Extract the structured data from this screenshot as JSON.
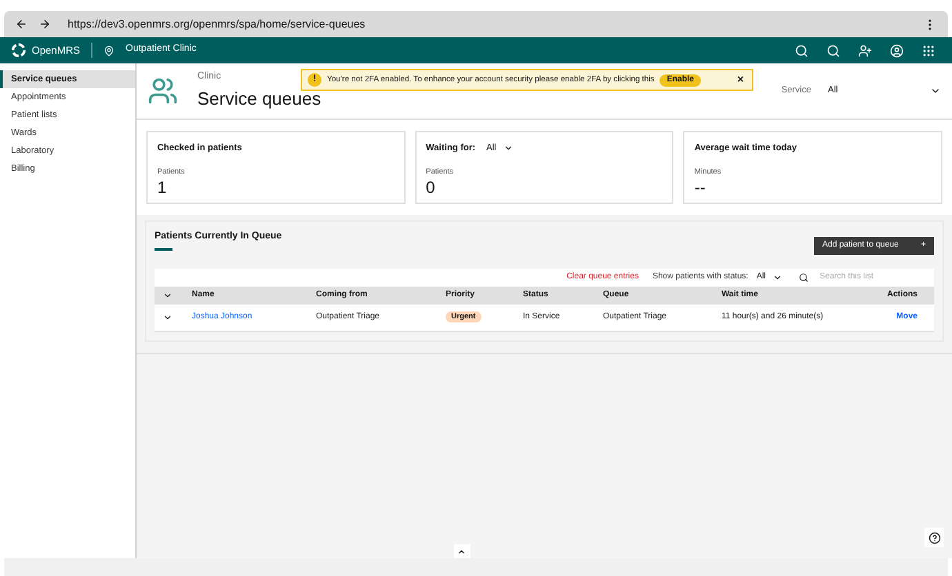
{
  "browser": {
    "url": "https://dev3.openmrs.org/openmrs/spa/home/service-queues"
  },
  "header": {
    "brand": "OpenMRS",
    "location": "Outpatient Clinic"
  },
  "sidebar": {
    "items": [
      {
        "label": "Service queues",
        "selected": true
      },
      {
        "label": "Appointments",
        "selected": false
      },
      {
        "label": "Patient lists",
        "selected": false
      },
      {
        "label": "Wards",
        "selected": false
      },
      {
        "label": "Laboratory",
        "selected": false
      },
      {
        "label": "Billing",
        "selected": false
      }
    ]
  },
  "page": {
    "subtitle": "Clinic",
    "title": "Service queues",
    "service_label": "Service",
    "service_value": "All"
  },
  "banner": {
    "icon": "!",
    "message": "You're not 2FA enabled. To enhance your account security please enable 2FA by clicking this",
    "action": "Enable",
    "close": "×"
  },
  "cards": [
    {
      "title": "Checked in patients",
      "label": "Patients",
      "value": "1"
    },
    {
      "title": "Waiting for:",
      "dropdown": "All",
      "label": "Patients",
      "value": "0"
    },
    {
      "title": "Average wait time today",
      "label": "Minutes",
      "value": "--"
    }
  ],
  "queue": {
    "title": "Patients Currently In Queue",
    "add_button": "Add patient to queue",
    "add_icon": "+",
    "clear": "Clear queue entries",
    "status_label": "Show patients with status:",
    "status_value": "All",
    "search_placeholder": "Search this list",
    "columns": [
      "Name",
      "Coming from",
      "Priority",
      "Status",
      "Queue",
      "Wait time",
      "Actions"
    ],
    "rows": [
      {
        "name": "Joshua Johnson",
        "coming_from": "Outpatient Triage",
        "priority": "Urgent",
        "status": "In Service",
        "queue": "Outpatient Triage",
        "wait_time": "11 hour(s) and 26 minute(s)",
        "action": "Move"
      }
    ]
  }
}
